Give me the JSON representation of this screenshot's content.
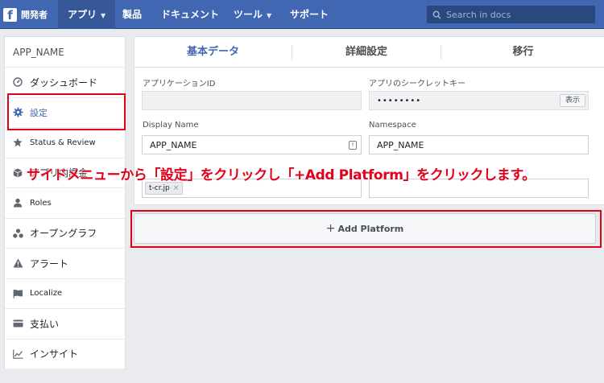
{
  "topbar": {
    "brand_label": "開発者",
    "nav": [
      {
        "label": "アプリ",
        "has_dropdown": true,
        "active": true
      },
      {
        "label": "製品"
      },
      {
        "label": "ドキュメント"
      },
      {
        "label": "ツール",
        "has_dropdown": true
      },
      {
        "label": "サポート"
      }
    ],
    "search_placeholder": "Search in docs",
    "search_icon": "search-icon"
  },
  "sidebar": {
    "app_name": "APP_NAME",
    "items": [
      {
        "label": "ダッシュボード",
        "icon": "dashboard-gauge-icon"
      },
      {
        "label": "設定",
        "icon": "gear-icon",
        "active": true
      },
      {
        "label": "Status & Review",
        "icon": "star-icon"
      },
      {
        "label": "アプリ内課金",
        "icon": "cube-icon"
      },
      {
        "label": "Roles",
        "icon": "person-icon"
      },
      {
        "label": "オープングラフ",
        "icon": "nodes-icon"
      },
      {
        "label": "アラート",
        "icon": "warning-icon"
      },
      {
        "label": "Localize",
        "icon": "flag-icon"
      },
      {
        "label": "支払い",
        "icon": "credit-card-icon"
      },
      {
        "label": "インサイト",
        "icon": "chart-icon"
      }
    ]
  },
  "tabs": [
    {
      "label": "基本データ",
      "active": true
    },
    {
      "label": "詳細設定"
    },
    {
      "label": "移行"
    }
  ],
  "form": {
    "app_id_label": "アプリケーションID",
    "app_id_value": "",
    "app_secret_label": "アプリのシークレットキー",
    "app_secret_value": "••••••••",
    "show_button": "表示",
    "display_name_label": "Display Name",
    "display_name_value": "APP_NAME",
    "namespace_label": "Namespace",
    "namespace_value": "APP_NAME",
    "domain_tag": "t-cr.jp",
    "tag_remove": "×"
  },
  "add_platform": {
    "plus": "+",
    "label": "Add Platform"
  },
  "annotation": "サイドメニューから「設定」をクリックし「+Add Platform」をクリックします。",
  "colors": {
    "brand": "#4267b2",
    "highlight": "#e3001b",
    "page_bg": "#e9ebee"
  }
}
